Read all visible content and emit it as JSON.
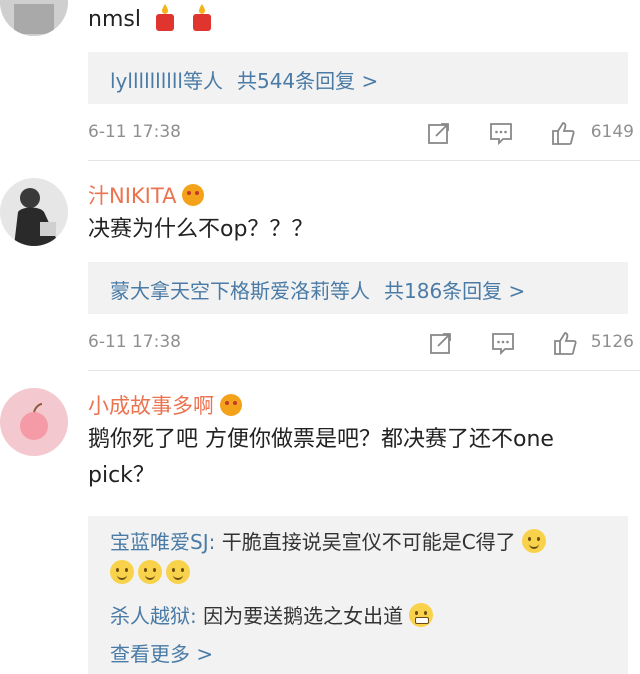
{
  "comments": [
    {
      "username": "",
      "text": "nmsl",
      "reply_summary": {
        "users": "lyllllllllll等人",
        "count_text": "共544条回复 >"
      },
      "time": "6-11 17:38",
      "likes": "6149"
    },
    {
      "username": "汁NIKITA",
      "text": "决赛为什么不op？？？",
      "reply_summary": {
        "users": "蒙大拿天空下格斯爱洛莉等人",
        "count_text": "共186条回复 >"
      },
      "time": "6-11 17:38",
      "likes": "5126"
    },
    {
      "username": "小成故事多啊",
      "text": "鹅你死了吧 方便你做票是吧？都决赛了还不one pick？",
      "replies": [
        {
          "user": "宝蓝唯爱SJ:",
          "text": " 干脆直接说吴宣仪不可能是C得了"
        },
        {
          "user": "杀人越狱:",
          "text": " 因为要送鹅选之女出道"
        }
      ],
      "more_text": "查看更多 >"
    }
  ],
  "icons": {
    "repost": "share-icon",
    "comment": "comment-icon",
    "like": "thumbs-up-icon"
  },
  "colors": {
    "username": "#eb7350",
    "link": "#4a7ba6",
    "reply_bg": "#f2f2f2",
    "meta": "#8f8f8f"
  }
}
